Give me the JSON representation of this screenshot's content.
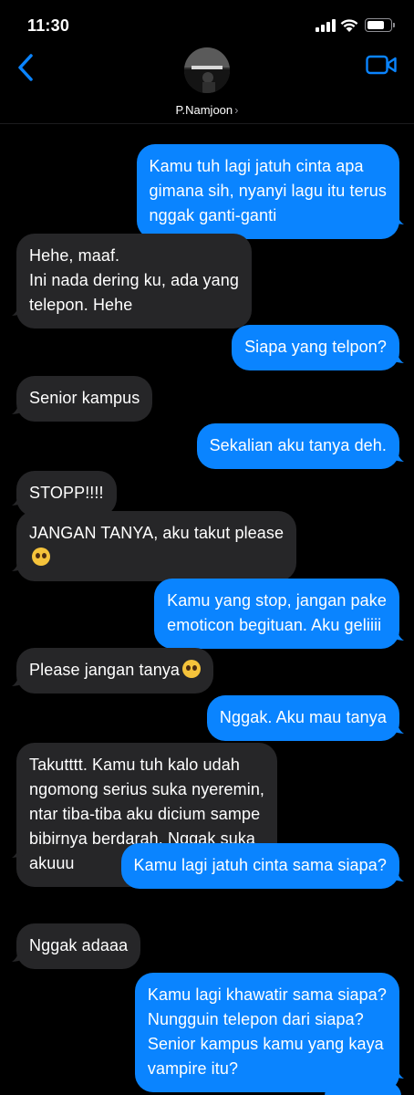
{
  "status_bar": {
    "time": "11:30",
    "icons": [
      "signal-icon",
      "wifi-icon",
      "battery-icon"
    ],
    "battery_level": 0.8
  },
  "header": {
    "contact_name": "P.Namjoon",
    "icons": [
      "back-chevron-icon",
      "avatar",
      "video-call-icon"
    ]
  },
  "colors": {
    "outgoing_bubble": "#0a84ff",
    "incoming_bubble": "#262628",
    "background": "#000000",
    "accent": "#0a84ff"
  },
  "messages": [
    {
      "from": "me",
      "lines": [
        "Kamu tuh lagi jatuh cinta apa",
        "gimana sih, nyanyi lagu itu terus",
        "nggak ganti-ganti"
      ]
    },
    {
      "from": "them",
      "lines": [
        "Hehe, maaf.",
        "Ini nada dering ku, ada yang",
        "telepon. Hehe"
      ]
    },
    {
      "from": "me",
      "lines": [
        "Siapa yang telpon?"
      ]
    },
    {
      "from": "them",
      "lines": [
        "Senior kampus"
      ]
    },
    {
      "from": "me",
      "lines": [
        "Sekalian aku tanya deh."
      ]
    },
    {
      "from": "them",
      "lines": [
        "STOPP!!!!"
      ]
    },
    {
      "from": "them",
      "lines": [
        "JANGAN TANYA, aku takut please",
        ""
      ],
      "emoji_line": 1
    },
    {
      "from": "me",
      "lines": [
        "Kamu yang stop, jangan pake",
        "emoticon begituan. Aku geliiii"
      ]
    },
    {
      "from": "them",
      "lines": [
        "Please jangan tanya"
      ],
      "emoji_line": 0
    },
    {
      "from": "me",
      "lines": [
        "Nggak. Aku mau tanya"
      ]
    },
    {
      "from": "them",
      "lines": [
        "Takutttt. Kamu tuh kalo udah",
        "ngomong serius suka nyeremin,",
        "ntar tiba-tiba aku dicium sampe",
        "bibirnya berdarah. Nggak suka",
        "akuuu"
      ]
    },
    {
      "from": "me",
      "lines": [
        "Kamu lagi jatuh cinta sama siapa?"
      ]
    },
    {
      "from": "them",
      "lines": [
        "Nggak adaaa"
      ]
    },
    {
      "from": "me",
      "lines": [
        "Kamu lagi khawatir sama siapa?",
        "Nungguin telepon dari siapa?",
        "Senior kampus kamu yang kaya",
        "vampire itu?"
      ]
    }
  ]
}
